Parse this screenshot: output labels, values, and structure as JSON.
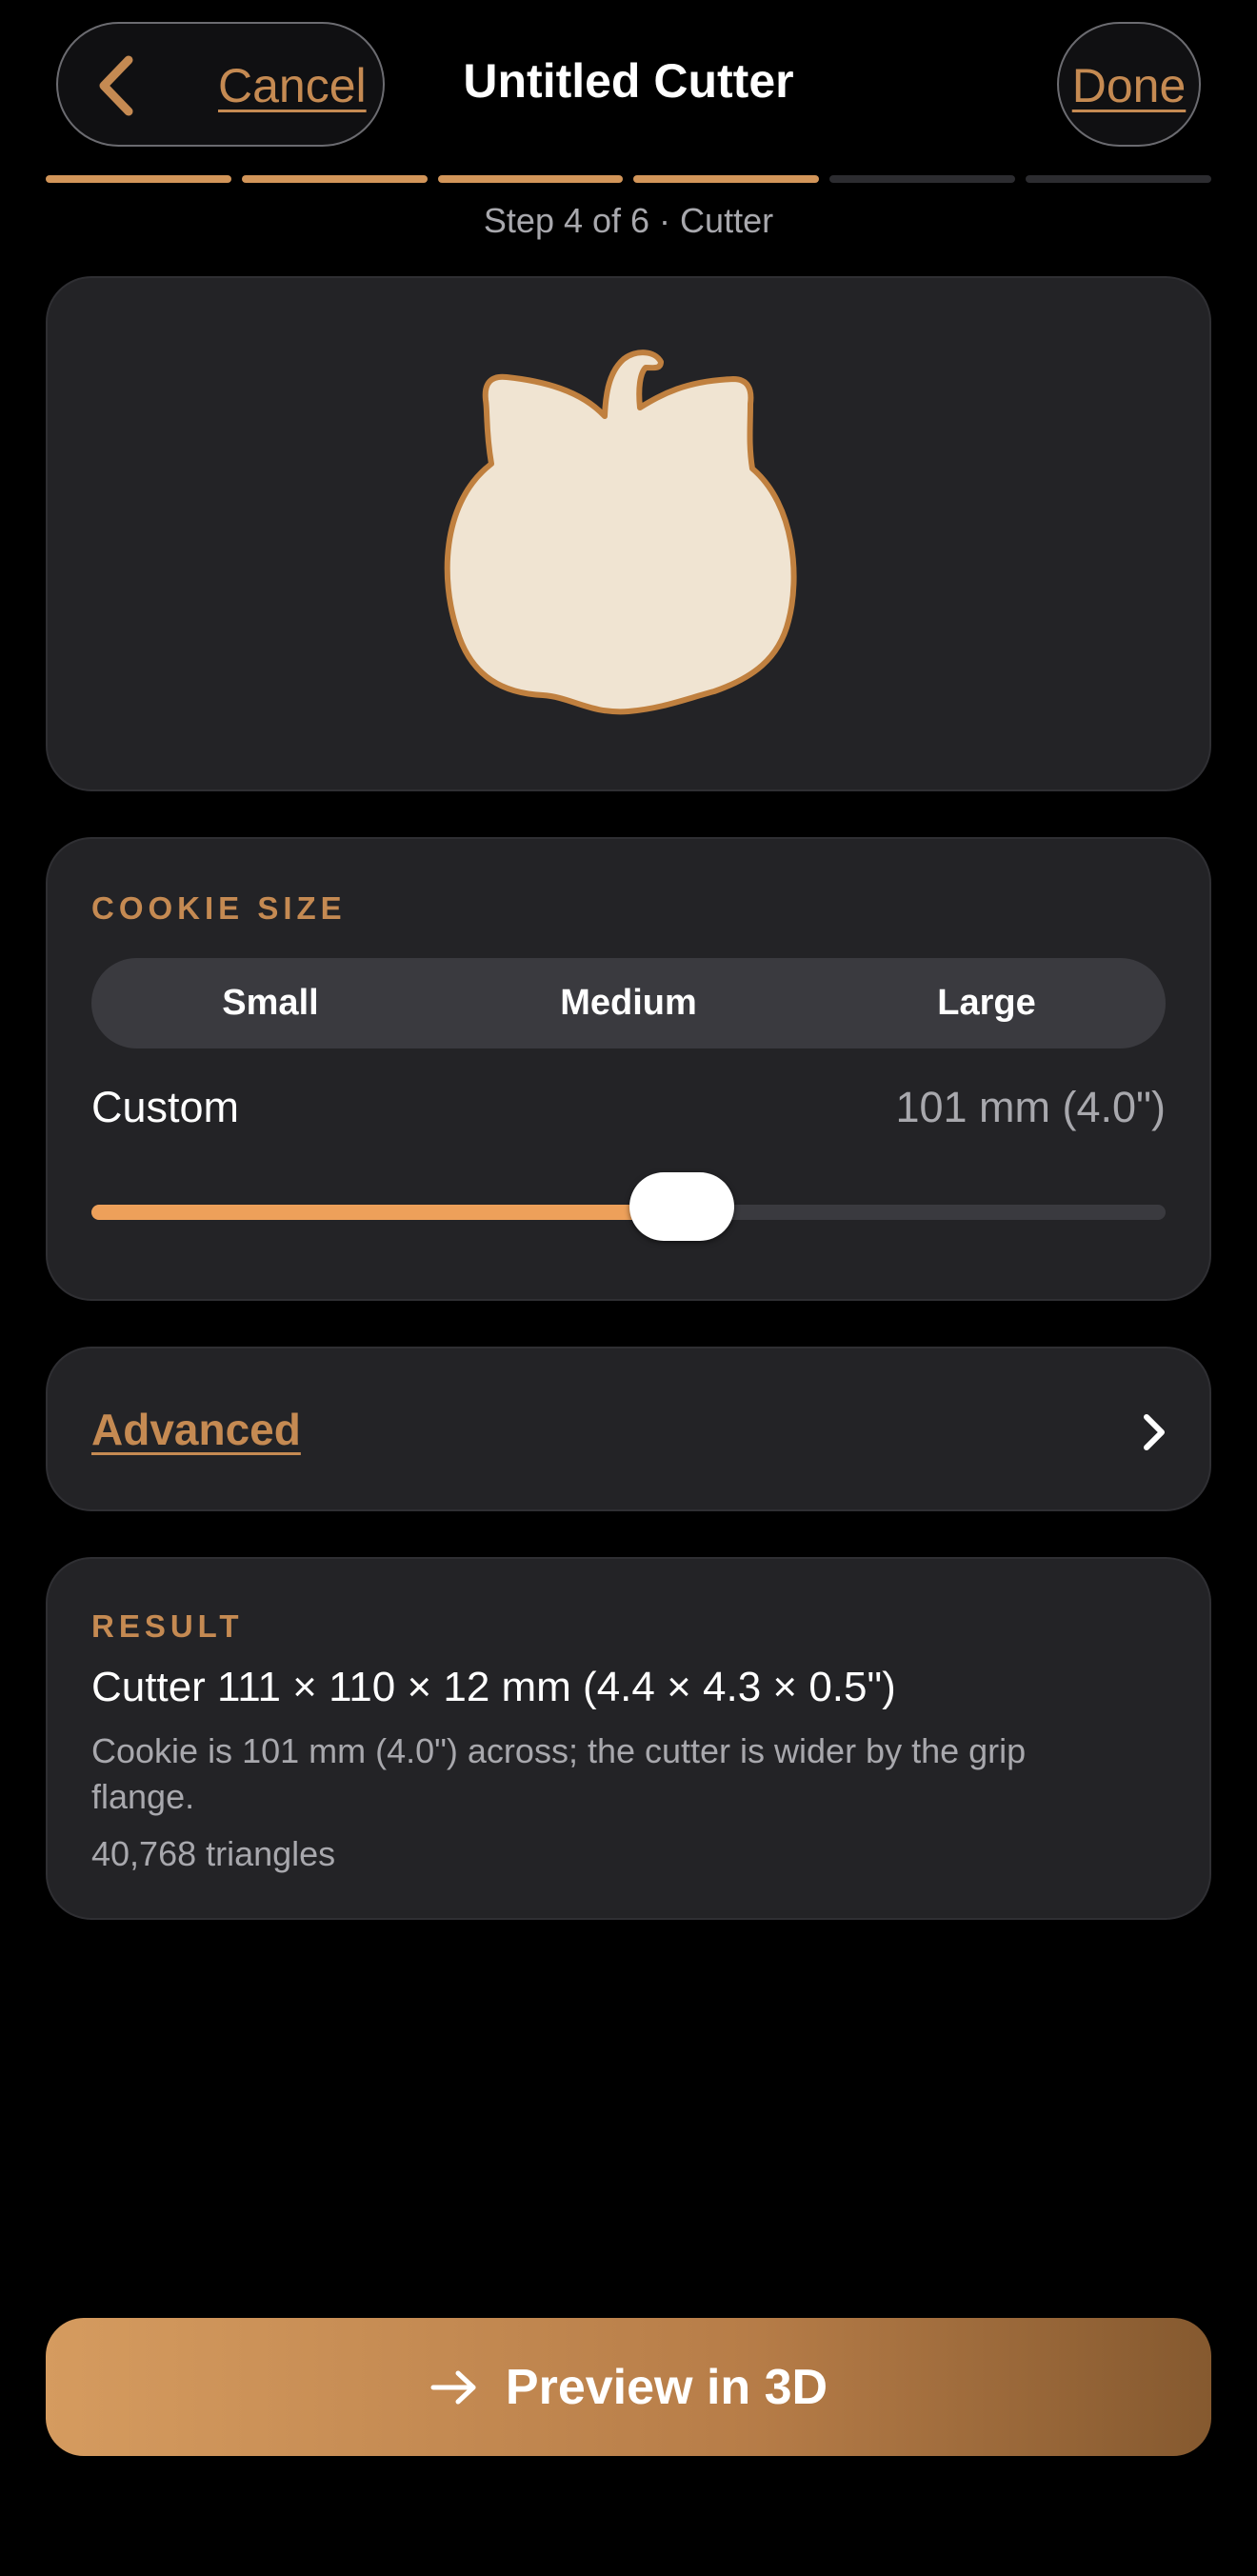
{
  "header": {
    "cancel_label": "Cancel",
    "title": "Untitled Cutter",
    "done_label": "Done"
  },
  "progress": {
    "total_steps": 6,
    "current_step": 4,
    "step_text": "Step 4 of 6 · Cutter"
  },
  "cookie_size": {
    "section_label": "COOKIE SIZE",
    "options": [
      "Small",
      "Medium",
      "Large"
    ],
    "custom_label": "Custom",
    "custom_value": "101 mm (4.0\")",
    "slider_fraction": 0.55
  },
  "advanced": {
    "label": "Advanced"
  },
  "result": {
    "section_label": "RESULT",
    "dimensions": "Cutter 111 × 110 × 12 mm (4.4 × 4.3 × 0.5\")",
    "note": "Cookie is 101 mm (4.0\") across; the cutter is wider by the grip flange.",
    "triangles": "40,768 triangles"
  },
  "cta": {
    "label": "Preview in 3D"
  },
  "colors": {
    "accent": "#c58a52",
    "shape_fill": "#f0e4d2",
    "shape_outline": "#c0803f",
    "slider_fill": "#eda05a"
  },
  "icons": {
    "back": "chevron-left-icon",
    "advanced": "chevron-right-icon",
    "cta": "arrow-right-icon"
  }
}
